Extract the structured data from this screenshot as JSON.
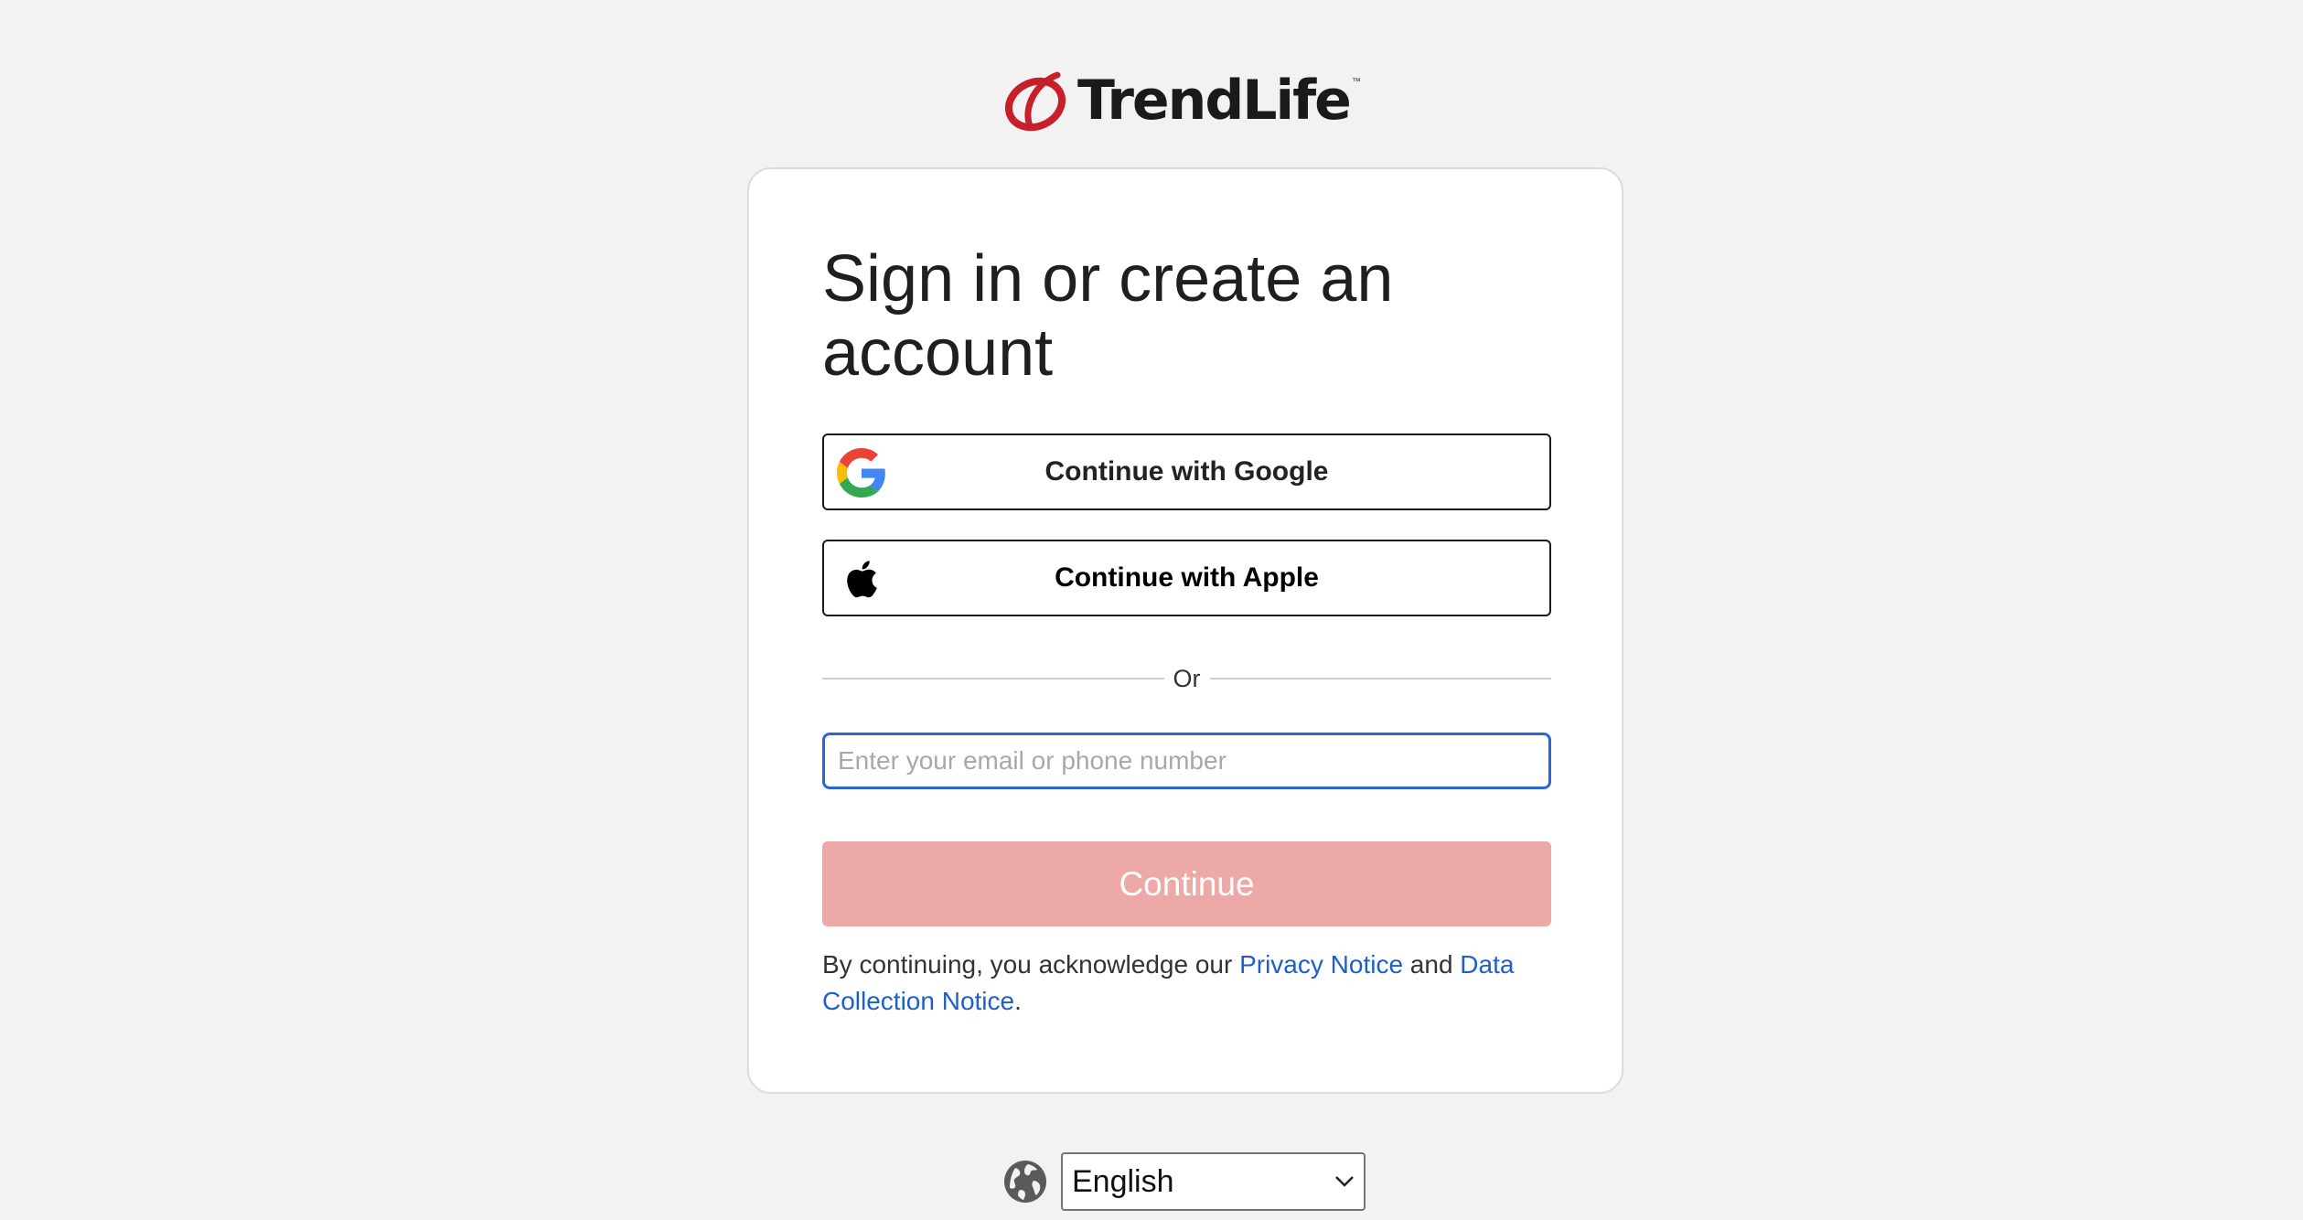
{
  "brand": {
    "name": "TrendLife",
    "tm": "™",
    "accent": "#c8202a"
  },
  "card": {
    "title": "Sign in or create an account",
    "google_label": "Continue with Google",
    "apple_label": "Continue with Apple",
    "divider_label": "Or",
    "email_placeholder": "Enter your email or phone number",
    "continue_label": "Continue",
    "legal": {
      "prefix": "By continuing, you acknowledge our ",
      "privacy_link": "Privacy Notice",
      "and": " and ",
      "data_link": "Data Collection Notice",
      "suffix": "."
    }
  },
  "language": {
    "selected": "English",
    "icon": "globe-icon"
  },
  "colors": {
    "background": "#f2f2f2",
    "input_focus": "#2a66d9",
    "continue_disabled": "#eca9a7",
    "link": "#1f5fc9"
  }
}
